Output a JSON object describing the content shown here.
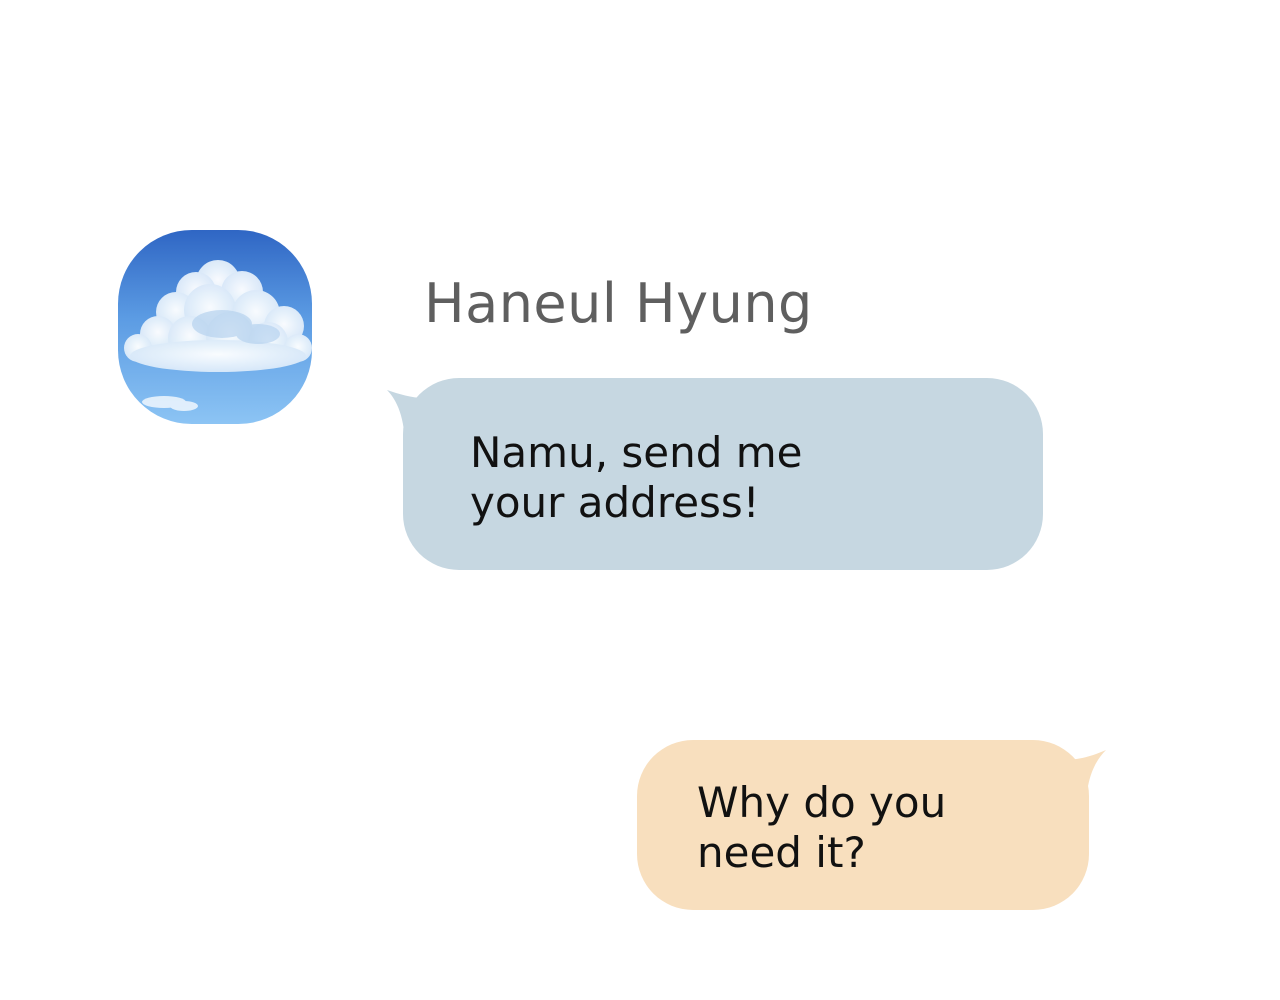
{
  "contact": {
    "name": "Haneul Hyung",
    "avatar_icon": "cloud-sky-avatar-icon"
  },
  "messages": [
    {
      "direction": "incoming",
      "text": "Namu, send me your address!"
    },
    {
      "direction": "outgoing",
      "text": "Why do you need it?"
    }
  ],
  "colors": {
    "background": "#ffffff",
    "incoming_bubble": "#c6d7e1",
    "outgoing_bubble": "#f8dfbe",
    "name_text": "#5f5f5f",
    "message_text": "#111111"
  }
}
